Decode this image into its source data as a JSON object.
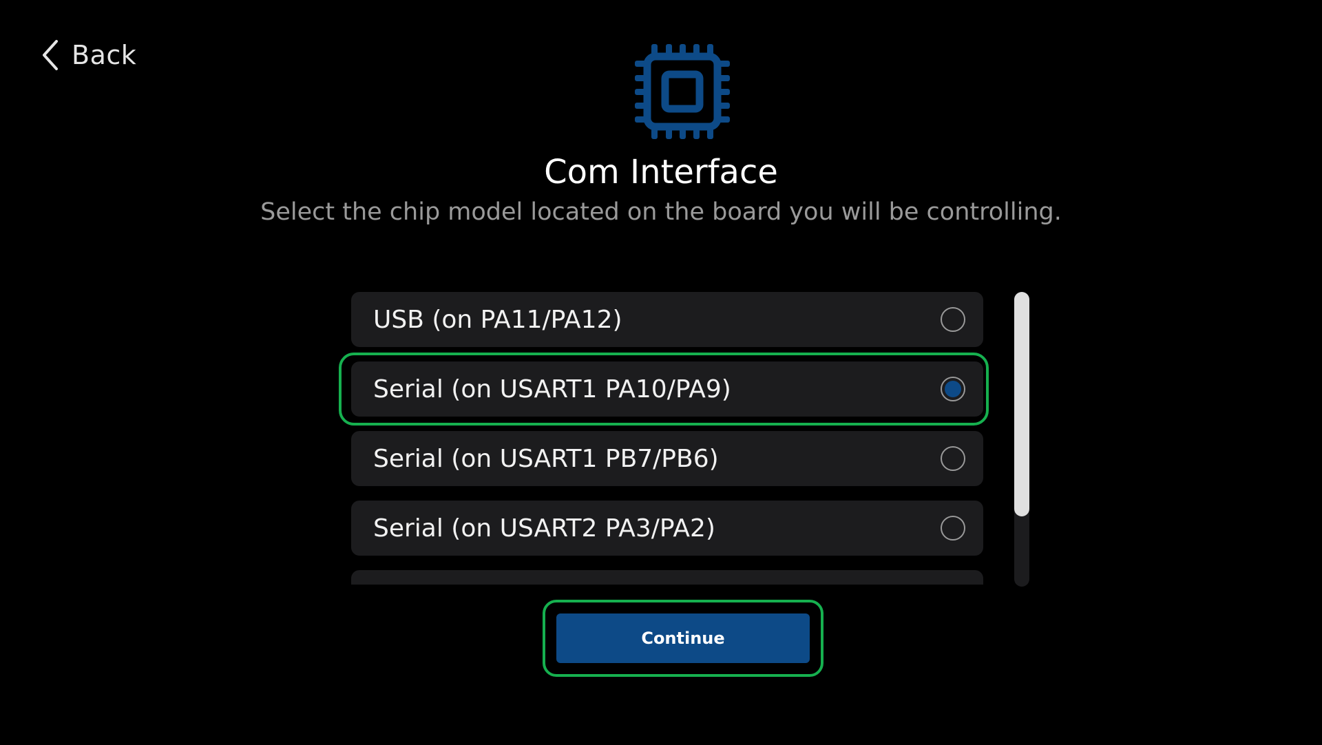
{
  "nav": {
    "back_label": "Back",
    "back_icon": "chevron-left-icon"
  },
  "header": {
    "icon": "chip-icon",
    "title": "Com Interface",
    "subtitle": "Select the chip model located on the board you will be controlling."
  },
  "options": [
    {
      "label": "USB (on PA11/PA12)",
      "selected": false
    },
    {
      "label": "Serial (on USART1 PA10/PA9)",
      "selected": true
    },
    {
      "label": "Serial (on USART1 PB7/PB6)",
      "selected": false
    },
    {
      "label": "Serial (on USART2 PA3/PA2)",
      "selected": false
    },
    {
      "label": "",
      "selected": false
    }
  ],
  "actions": {
    "continue_label": "Continue"
  },
  "colors": {
    "accent": "#0d4a87",
    "highlight": "#16b04f",
    "row_background": "#1c1c1e",
    "background": "#000000"
  }
}
